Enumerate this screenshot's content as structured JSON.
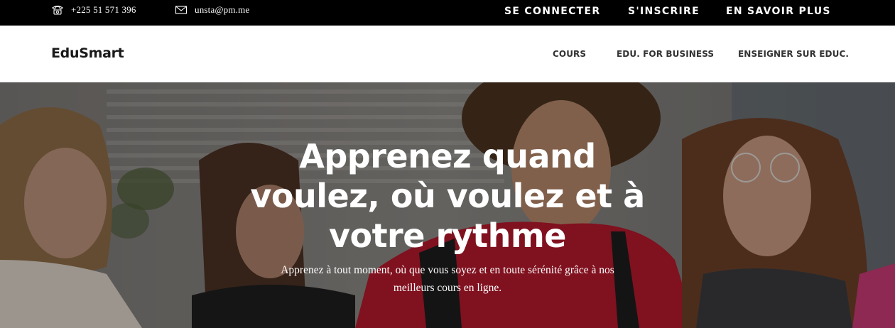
{
  "topbar": {
    "phone": "+225 51 571 396",
    "email": "unsta@pm.me",
    "links": [
      "SE CONNECTER",
      "S'INSCRIRE",
      "EN SAVOIR PLUS"
    ]
  },
  "nav": {
    "brand": "EduSmart",
    "items": [
      "COURS",
      "EDU. FOR BUSINESS",
      "ENSEIGNER SUR EDUC."
    ]
  },
  "hero": {
    "title": "Apprenez quand voulez, où voulez et à votre rythme",
    "subtitle": "Apprenez à tout moment, où que vous soyez et en toute sérénité grâce à nos meilleurs cours en ligne."
  },
  "icons": {
    "phone": "phone-icon",
    "email": "envelope-icon"
  },
  "colors": {
    "topbar_bg": "#000000",
    "nav_bg": "#ffffff",
    "text_dark": "#1a1a1a",
    "hero_shirt": "#b2182b"
  }
}
